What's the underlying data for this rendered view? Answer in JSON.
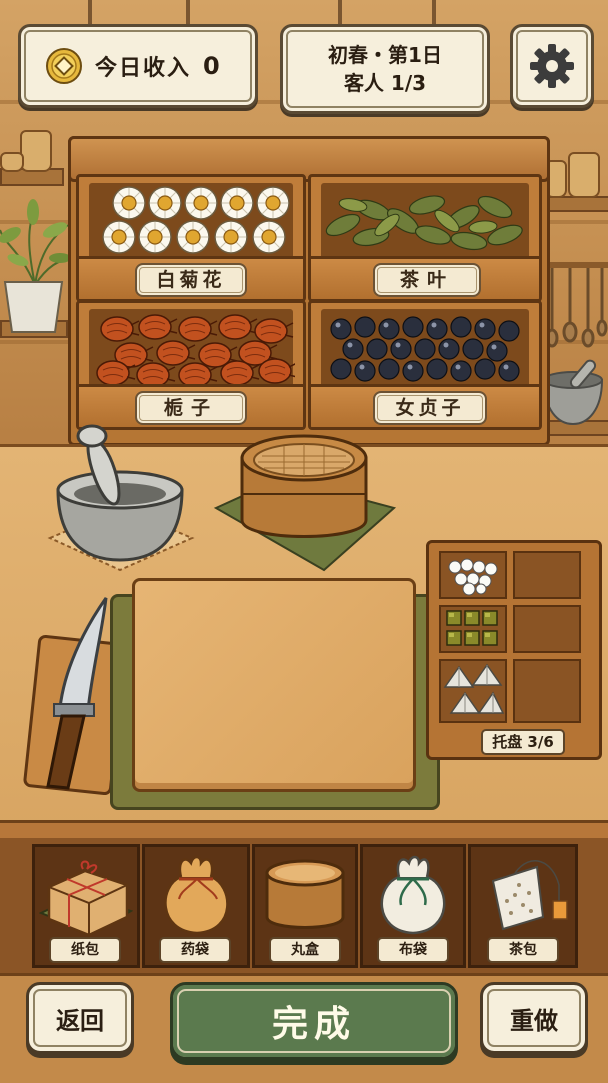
{
  "hud": {
    "income_label": "今日收入",
    "income_value": "0",
    "season_day": "初春・第1日",
    "customers": "客人 1/3",
    "settings_icon": "gear-icon"
  },
  "drawers": [
    {
      "label": "白菊花",
      "icon": "chrysanthemum-icon"
    },
    {
      "label": "茶叶",
      "icon": "tea-leaf-icon"
    },
    {
      "label": "栀子",
      "icon": "gardenia-fruit-icon"
    },
    {
      "label": "女贞子",
      "icon": "privet-berry-icon"
    }
  ],
  "tools": {
    "mortar_icon": "mortar-pestle-icon",
    "sieve_icon": "sieve-icon",
    "knife_icon": "knife-icon",
    "board_icon": "cutting-board-icon"
  },
  "tray": {
    "label": "托盘 3/6",
    "slots": [
      "white-pellets",
      "green-cubes",
      "wrapped-pyramids",
      "empty",
      "empty",
      "empty"
    ]
  },
  "packaging": [
    {
      "label": "纸包",
      "icon": "paper-package-icon"
    },
    {
      "label": "药袋",
      "icon": "medicine-pouch-icon"
    },
    {
      "label": "丸盒",
      "icon": "pill-box-icon"
    },
    {
      "label": "布袋",
      "icon": "cloth-bag-icon"
    },
    {
      "label": "茶包",
      "icon": "teabag-icon"
    }
  ],
  "buttons": {
    "back": "返回",
    "done": "完成",
    "redo": "重做"
  },
  "colors": {
    "accent_green": "#5b7a4e",
    "panel": "#f6efdc",
    "wood": "#d8a562"
  }
}
